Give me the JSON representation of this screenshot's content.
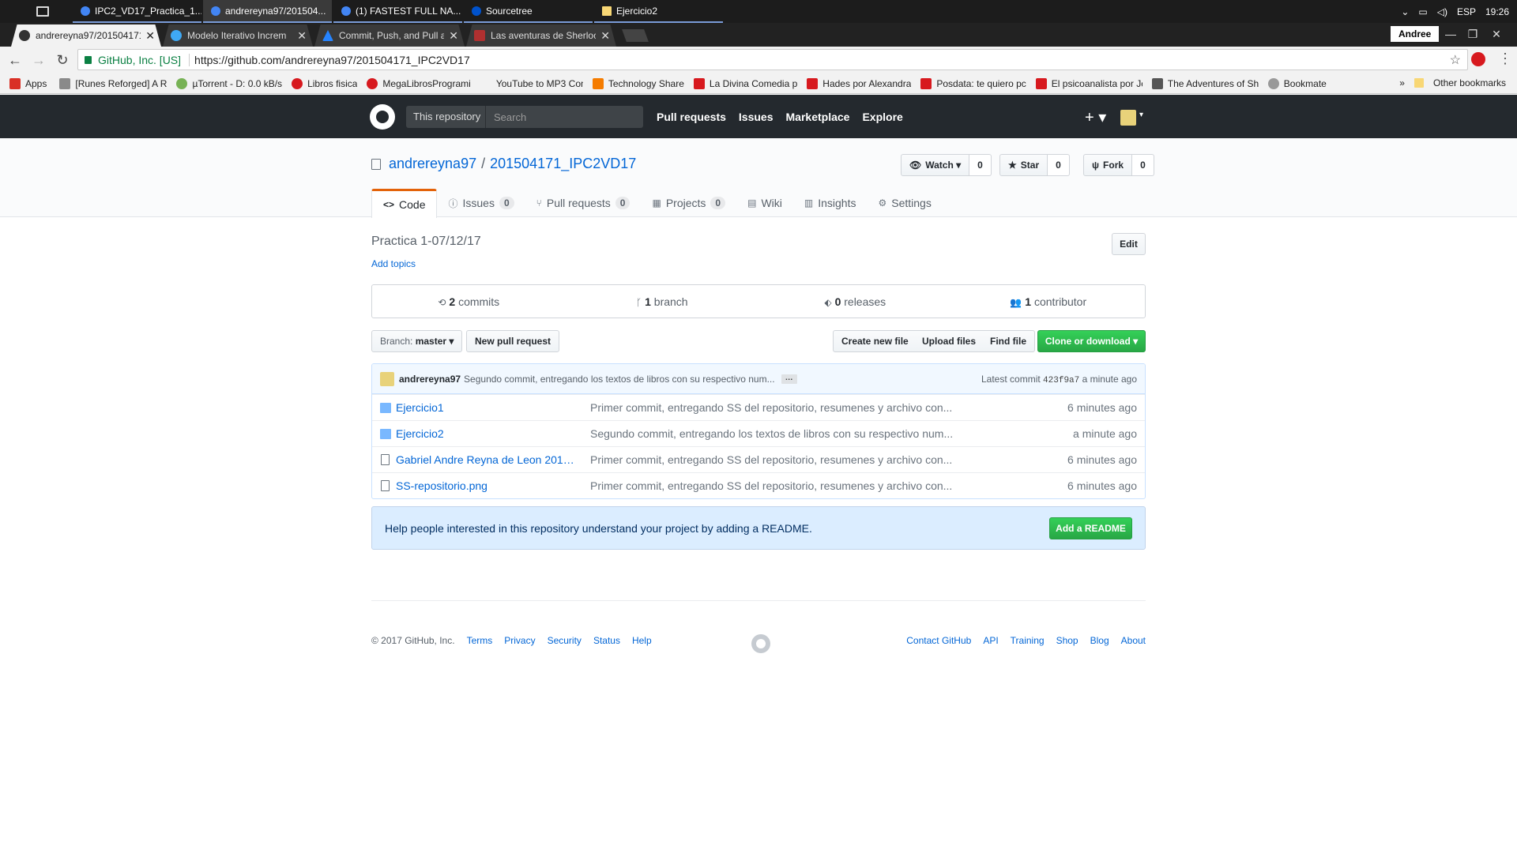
{
  "taskbar": {
    "items": [
      {
        "label": "IPC2_VD17_Practica_1...",
        "color": "#4285f4"
      },
      {
        "label": "andrereyna97/201504...",
        "color": "#4285f4"
      },
      {
        "label": "(1) FASTEST FULL NA...",
        "color": "#4285f4"
      },
      {
        "label": "Sourcetree",
        "color": "#0052cc"
      },
      {
        "label": "Ejercicio2",
        "color": "#f8d775"
      }
    ],
    "tray": {
      "lang": "ESP",
      "time": "19:26"
    }
  },
  "chrome": {
    "tabs": [
      {
        "label": "andrereyna97/201504171",
        "icon": "github-icon"
      },
      {
        "label": "Modelo Iterativo Increm",
        "icon": "s-icon"
      },
      {
        "label": "Commit, Push, and Pull a",
        "icon": "atlassian-icon"
      },
      {
        "label": "Las aventuras de Sherloc",
        "icon": "book-icon"
      }
    ],
    "profile": "Andree",
    "secure_label": "GitHub, Inc. [US]",
    "url": "https://github.com/andrereyna97/201504171_IPC2VD17"
  },
  "bookmarks": {
    "items": [
      {
        "label": "Apps",
        "color": "#d93025"
      },
      {
        "label": "[Runes Reforged] A R",
        "color": "#8a8a8a"
      },
      {
        "label": "µTorrent - D: 0.0 kB/s",
        "color": "#77b255"
      },
      {
        "label": "Libros fisica",
        "color": "#d7191e"
      },
      {
        "label": "MegaLibrosProgrami",
        "color": "#d7191e"
      },
      {
        "label": "YouTube to MP3 Con",
        "color": "#f2f2f2"
      },
      {
        "label": "Technology Share",
        "color": "#f57c00"
      },
      {
        "label": "La Divina Comedia p",
        "color": "#d7191e"
      },
      {
        "label": "Hades por Alexandra",
        "color": "#d7191e"
      },
      {
        "label": "Posdata: te quiero pc",
        "color": "#d7191e"
      },
      {
        "label": "El psicoanalista por Jc",
        "color": "#d7191e"
      },
      {
        "label": "The Adventures of Sh",
        "color": "#555"
      },
      {
        "label": "Bookmate",
        "color": "#999"
      }
    ],
    "more": "»",
    "other": "Other bookmarks"
  },
  "gh_header": {
    "scope": "This repository",
    "search_placeholder": "Search",
    "nav": [
      "Pull requests",
      "Issues",
      "Marketplace",
      "Explore"
    ],
    "plus": "+ ▾"
  },
  "repo": {
    "owner": "andrereyna97",
    "sep": "/",
    "name": "201504171_IPC2VD17",
    "watch": {
      "label": "Watch ▾",
      "count": "0"
    },
    "star": {
      "label": "Star",
      "count": "0"
    },
    "fork": {
      "label": "Fork",
      "count": "0"
    },
    "tabs": [
      {
        "label": "Code",
        "count": ""
      },
      {
        "label": "Issues",
        "count": "0"
      },
      {
        "label": "Pull requests",
        "count": "0"
      },
      {
        "label": "Projects",
        "count": "0"
      },
      {
        "label": "Wiki",
        "count": ""
      },
      {
        "label": "Insights",
        "count": ""
      },
      {
        "label": "Settings",
        "count": ""
      }
    ],
    "description": "Practica 1-07/12/17",
    "add_topics": "Add topics",
    "edit": "Edit",
    "numbers": [
      {
        "count": "2",
        "label": "commits"
      },
      {
        "count": "1",
        "label": "branch"
      },
      {
        "count": "0",
        "label": "releases"
      },
      {
        "count": "1",
        "label": "contributor"
      }
    ],
    "branch_label": "Branch:",
    "branch_value": "master ▾",
    "new_pr": "New pull request",
    "create_file": "Create new file",
    "upload": "Upload files",
    "find": "Find file",
    "clone": "Clone or download ▾",
    "latest_commit": {
      "author": "andrereyna97",
      "message": "Segundo commit, entregando los textos de libros con su respectivo num...",
      "ellipsis": "…",
      "prefix": "Latest commit",
      "sha": "423f9a7",
      "age": "a minute ago"
    },
    "files": [
      {
        "type": "dir",
        "name": "Ejercicio1",
        "message": "Primer commit, entregando SS del repositorio, resumenes y archivo con...",
        "age": "6 minutes ago"
      },
      {
        "type": "dir",
        "name": "Ejercicio2",
        "message": "Segundo commit, entregando los textos de libros con su respectivo num...",
        "age": "a minute ago"
      },
      {
        "type": "file",
        "name": "Gabriel Andre Reyna de Leon 20150...",
        "message": "Primer commit, entregando SS del repositorio, resumenes y archivo con...",
        "age": "6 minutes ago"
      },
      {
        "type": "file",
        "name": "SS-repositorio.png",
        "message": "Primer commit, entregando SS del repositorio, resumenes y archivo con...",
        "age": "6 minutes ago"
      }
    ],
    "readme_text": "Help people interested in this repository understand your project by adding a README.",
    "readme_button": "Add a README"
  },
  "footer": {
    "copyright": "© 2017 GitHub, Inc.",
    "left_links": [
      "Terms",
      "Privacy",
      "Security",
      "Status",
      "Help"
    ],
    "right_links": [
      "Contact GitHub",
      "API",
      "Training",
      "Shop",
      "Blog",
      "About"
    ]
  }
}
